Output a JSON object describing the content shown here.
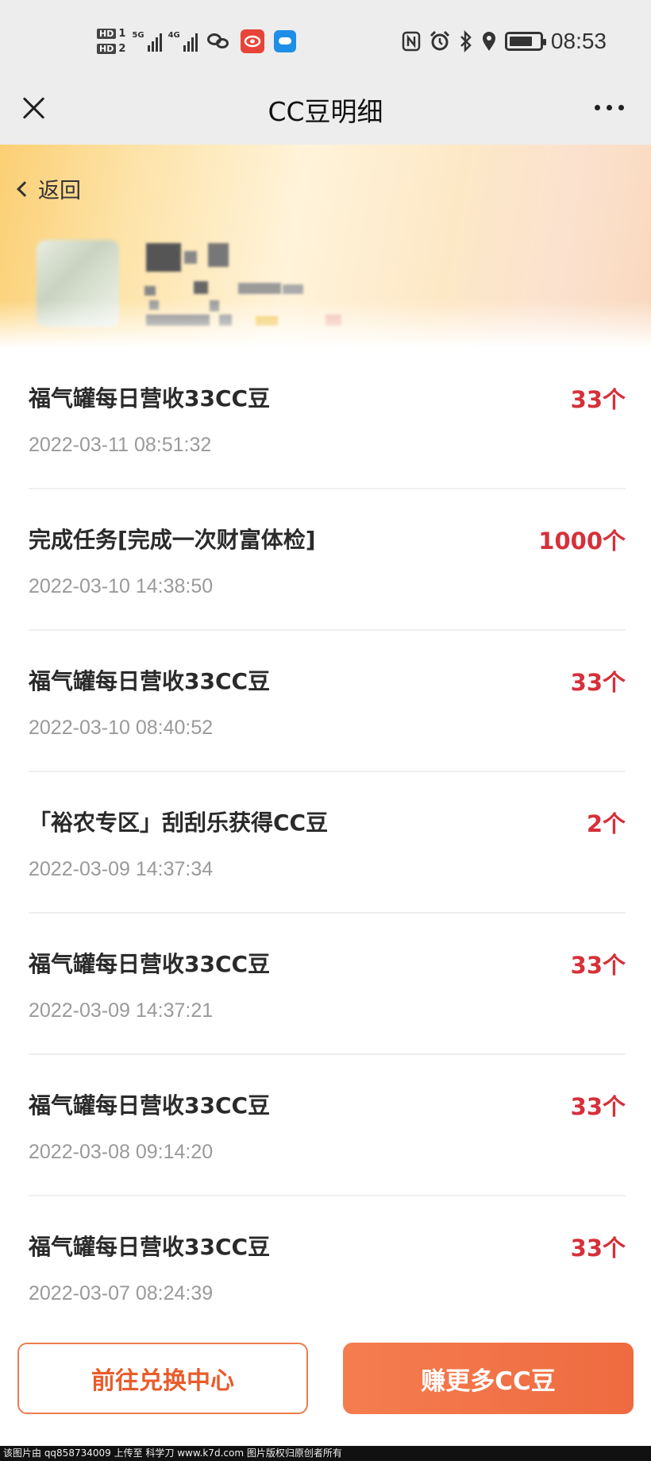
{
  "status_bar": {
    "hd1": "HD",
    "hd1_num": "1",
    "hd2": "HD",
    "hd2_num": "2",
    "signal1_label": "5G",
    "signal2_label": "4G",
    "app_icon_red_label": "",
    "time": "08:53",
    "icons": [
      "nfc-icon",
      "alarm-icon",
      "bluetooth-icon",
      "location-icon",
      "battery-icon"
    ]
  },
  "nav": {
    "title": "CC豆明细"
  },
  "header": {
    "back_label": "返回"
  },
  "records": [
    {
      "title": "福气罐每日营收33CC豆",
      "time": "2022-03-11 08:51:32",
      "amount": "33个"
    },
    {
      "title": "完成任务[完成一次财富体检]",
      "time": "2022-03-10 14:38:50",
      "amount": "1000个"
    },
    {
      "title": "福气罐每日营收33CC豆",
      "time": "2022-03-10 08:40:52",
      "amount": "33个"
    },
    {
      "title": "「裕农专区」刮刮乐获得CC豆",
      "time": "2022-03-09 14:37:34",
      "amount": "2个"
    },
    {
      "title": "福气罐每日营收33CC豆",
      "time": "2022-03-09 14:37:21",
      "amount": "33个"
    },
    {
      "title": "福气罐每日营收33CC豆",
      "time": "2022-03-08 09:14:20",
      "amount": "33个"
    },
    {
      "title": "福气罐每日营收33CC豆",
      "time": "2022-03-07 08:24:39",
      "amount": "33个"
    }
  ],
  "buttons": {
    "exchange": "前往兑换中心",
    "earn_more": "赚更多CC豆"
  },
  "watermark": "该图片由 qq858734009 上传至 科学刀 www.k7d.com 图片版权归原创者所有",
  "colors": {
    "amount": "#d6303a",
    "accent": "#ef6a40",
    "outline_button_text": "#e85c2c"
  }
}
